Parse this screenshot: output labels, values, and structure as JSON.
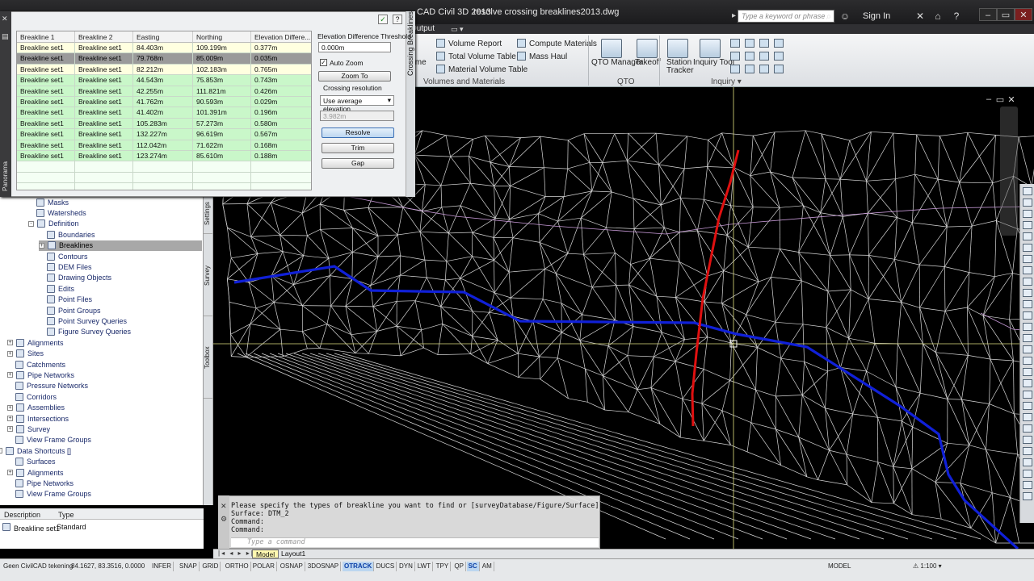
{
  "titlebar": {
    "app_name": "CAD Civil 3D 2013",
    "document": "resolve crossing breaklines2013.dwg",
    "search_placeholder": "Type a keyword or phrase",
    "sign_in": "Sign In"
  },
  "ribbon": {
    "tab_output": "Output",
    "col1": [
      "lume"
    ],
    "col2": [
      "Volume Report",
      "Total Volume Table",
      "Material Volume Table"
    ],
    "col3": [
      "Compute Materials",
      "Mass Haul"
    ],
    "panel_volumes": "Volumes and Materials",
    "qto_manager": "QTO Manager",
    "takeoff": "Takeoff",
    "panel_qto": "QTO",
    "station_tracker_line1": "Station",
    "station_tracker_line2": "Tracker",
    "inquiry_tool": "Inquiry Tool",
    "panel_inquiry": "Inquiry"
  },
  "panorama": {
    "title": "Crossing Breaklines",
    "side_label": "Panorama",
    "columns": [
      "Breakline 1",
      "Breakline 2",
      "Easting",
      "Northing",
      "Elevation Differe..."
    ],
    "rows": [
      {
        "b1": "Breakline set1",
        "b2": "Breakline set1",
        "e": "84.403m",
        "n": "109.199m",
        "d": "0.377m",
        "state": "cream"
      },
      {
        "b1": "Breakline set1",
        "b2": "Breakline set1",
        "e": "79.768m",
        "n": "85.009m",
        "d": "0.035m",
        "state": "selected"
      },
      {
        "b1": "Breakline set1",
        "b2": "Breakline set1",
        "e": "82.212m",
        "n": "102.183m",
        "d": "0.765m",
        "state": "cream"
      },
      {
        "b1": "Breakline set1",
        "b2": "Breakline set1",
        "e": "44.543m",
        "n": "75.853m",
        "d": "0.743m",
        "state": "green"
      },
      {
        "b1": "Breakline set1",
        "b2": "Breakline set1",
        "e": "42.255m",
        "n": "111.821m",
        "d": "0.426m",
        "state": "green"
      },
      {
        "b1": "Breakline set1",
        "b2": "Breakline set1",
        "e": "41.762m",
        "n": "90.593m",
        "d": "0.029m",
        "state": "green"
      },
      {
        "b1": "Breakline set1",
        "b2": "Breakline set1",
        "e": "41.402m",
        "n": "101.391m",
        "d": "0.196m",
        "state": "green"
      },
      {
        "b1": "Breakline set1",
        "b2": "Breakline set1",
        "e": "105.283m",
        "n": "57.273m",
        "d": "0.580m",
        "state": "green"
      },
      {
        "b1": "Breakline set1",
        "b2": "Breakline set1",
        "e": "132.227m",
        "n": "96.619m",
        "d": "0.567m",
        "state": "green"
      },
      {
        "b1": "Breakline set1",
        "b2": "Breakline set1",
        "e": "112.042m",
        "n": "71.622m",
        "d": "0.168m",
        "state": "green"
      },
      {
        "b1": "Breakline set1",
        "b2": "Breakline set1",
        "e": "123.274m",
        "n": "85.610m",
        "d": "0.188m",
        "state": "green"
      }
    ],
    "threshold_label": "Elevation Difference Threshold",
    "threshold_value": "0.000m",
    "auto_zoom_label": "Auto Zoom",
    "auto_zoom_checked": true,
    "zoom_to": "Zoom To",
    "resolution_label": "Crossing resolution",
    "resolution_option": "Use average elevation",
    "resolution_value": "3.982m",
    "resolve": "Resolve",
    "trim": "Trim",
    "gap": "Gap"
  },
  "prospector": {
    "items": [
      {
        "label": "Masks",
        "indent": 3
      },
      {
        "label": "Watersheds",
        "indent": 3
      },
      {
        "label": "Definition",
        "indent": 3,
        "expander": "-"
      },
      {
        "label": "Boundaries",
        "indent": 4
      },
      {
        "label": "Breaklines",
        "indent": 4,
        "expander": "+",
        "selected": true
      },
      {
        "label": "Contours",
        "indent": 4
      },
      {
        "label": "DEM Files",
        "indent": 4
      },
      {
        "label": "Drawing Objects",
        "indent": 4
      },
      {
        "label": "Edits",
        "indent": 4
      },
      {
        "label": "Point Files",
        "indent": 4
      },
      {
        "label": "Point Groups",
        "indent": 4
      },
      {
        "label": "Point Survey Queries",
        "indent": 4
      },
      {
        "label": "Figure Survey Queries",
        "indent": 4
      },
      {
        "label": "Alignments",
        "indent": 1,
        "expander": "+"
      },
      {
        "label": "Sites",
        "indent": 1,
        "expander": "+"
      },
      {
        "label": "Catchments",
        "indent": 1
      },
      {
        "label": "Pipe Networks",
        "indent": 1,
        "expander": "+"
      },
      {
        "label": "Pressure Networks",
        "indent": 1
      },
      {
        "label": "Corridors",
        "indent": 1
      },
      {
        "label": "Assemblies",
        "indent": 1,
        "expander": "+"
      },
      {
        "label": "Intersections",
        "indent": 1,
        "expander": "+"
      },
      {
        "label": "Survey",
        "indent": 1,
        "expander": "+"
      },
      {
        "label": "View Frame Groups",
        "indent": 1
      },
      {
        "label": "Data Shortcuts []",
        "indent": 0,
        "expander": "-"
      },
      {
        "label": "Surfaces",
        "indent": 1
      },
      {
        "label": "Alignments",
        "indent": 1,
        "expander": "+"
      },
      {
        "label": "Pipe Networks",
        "indent": 1
      },
      {
        "label": "View Frame Groups",
        "indent": 1
      }
    ],
    "side_tabs": [
      "Settings",
      "Survey",
      "Toolbox"
    ]
  },
  "item_list": {
    "col_description": "Description",
    "col_type": "Type",
    "row_description": "Breakline set1",
    "row_type": "Standard"
  },
  "command_line": {
    "lines": [
      "Please specify the types of breakline you want to find or [surveyDatabase/Figure/Surface]: S",
      "Surface:  DTM_2",
      "Command:",
      "Command:"
    ],
    "placeholder": "Type a command"
  },
  "layout_tabs": {
    "model": "Model",
    "layout1": "Layout1"
  },
  "statusbar": {
    "drawing_name": "Geen CivilCAD tekening",
    "coordinates": "84.1627, 83.3516, 0.0000",
    "toggles": [
      {
        "label": "INFER",
        "on": false
      },
      {
        "label": "SNAP",
        "on": false
      },
      {
        "label": "GRID",
        "on": false
      },
      {
        "label": "ORTHO",
        "on": false
      },
      {
        "label": "POLAR",
        "on": false
      },
      {
        "label": "OSNAP",
        "on": false
      },
      {
        "label": "3DOSNAP",
        "on": false
      },
      {
        "label": "OTRACK",
        "on": true
      },
      {
        "label": "DUCS",
        "on": false
      },
      {
        "label": "DYN",
        "on": false
      },
      {
        "label": "LWT",
        "on": false
      },
      {
        "label": "TPY",
        "on": false
      },
      {
        "label": "QP",
        "on": false
      },
      {
        "label": "SC",
        "on": true
      },
      {
        "label": "AM",
        "on": false
      }
    ],
    "model": "MODEL",
    "scale": "1:100"
  },
  "colors": {
    "breakline_red": "#e01010",
    "breakline_blue": "#1020d8",
    "tin_lines": "#d8d8d8",
    "crosshair": "#e0e080",
    "row_green": "#c9f7c9",
    "row_cream": "#ffffe0",
    "row_selected": "#9a9a9a"
  },
  "icons": [
    "check-icon",
    "help-icon",
    "search-icon",
    "close-icon",
    "minimize-icon",
    "maximize-icon"
  ]
}
